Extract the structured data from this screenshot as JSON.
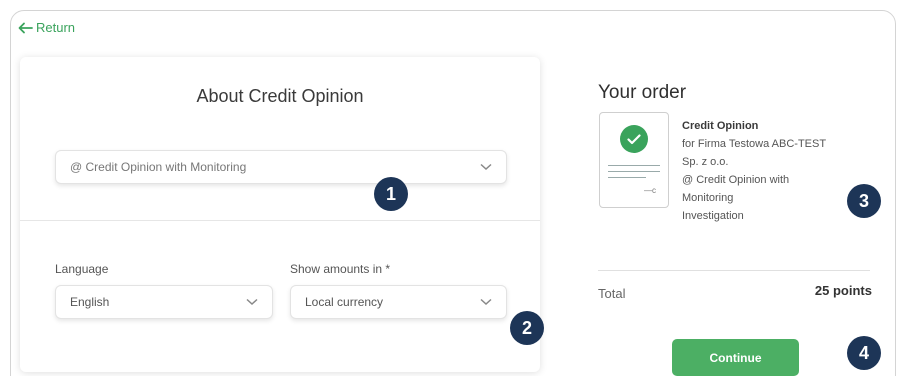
{
  "nav": {
    "return_label": "Return"
  },
  "product_form": {
    "title": "About Credit Opinion",
    "product_select_value": "@ Credit Opinion with Monitoring",
    "language_label": "Language",
    "language_value": "English",
    "amounts_label": "Show amounts in *",
    "amounts_value": "Local currency"
  },
  "order": {
    "title": "Your order",
    "product_name": "Credit Opinion",
    "details_lines": [
      "for Firma Testowa ABC-TEST",
      "Sp. z o.o.",
      "@ Credit Opinion with",
      "Monitoring",
      "Investigation"
    ],
    "doc_mark": "—c",
    "total_label": "Total",
    "total_value": "25 points",
    "continue_label": "Continue"
  },
  "badges": [
    "1",
    "2",
    "3",
    "4"
  ],
  "colors": {
    "accent_green": "#3aa35c",
    "badge_navy": "#1d3557"
  }
}
